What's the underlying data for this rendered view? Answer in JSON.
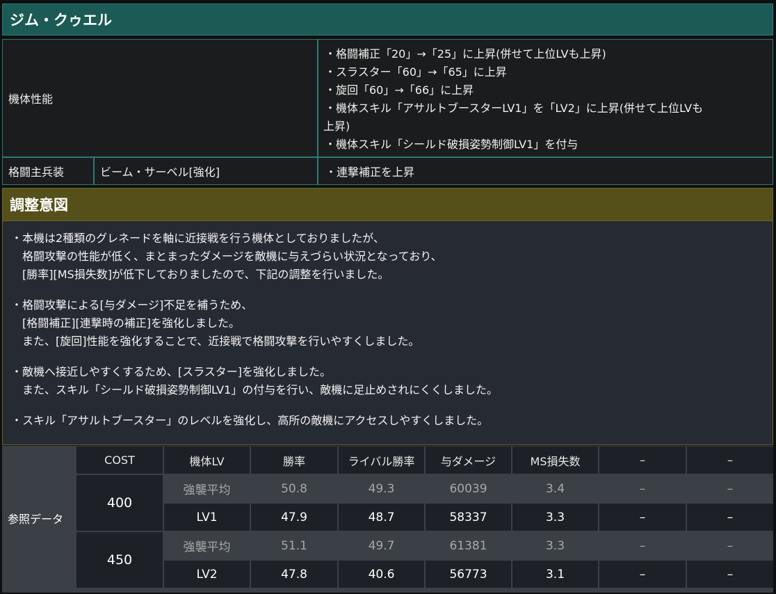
{
  "title": "ジム・クゥエル",
  "performance": {
    "label": "機体性能",
    "items": [
      "・格闘補正「20」→「25」に上昇(併せて上位LVも上昇)",
      "・スラスター「60」→「65」に上昇",
      "・旋回「60」→「66」に上昇",
      "・機体スキル「アサルトブースターLV1」を「LV2」に上昇(併せて上位LVも",
      "上昇)",
      "・機体スキル「シールド破損姿勢制御LV1」を付与"
    ]
  },
  "weapon": {
    "label": "格闘主兵装",
    "name": "ビーム・サーベル[強化]",
    "change": "・連撃補正を上昇"
  },
  "intent": {
    "title": "調整意図",
    "paragraphs": [
      [
        "・本機は2種類のグレネードを軸に近接戦を行う機体としておりましたが、",
        "　格闘攻撃の性能が低く、まとまったダメージを敵機に与えづらい状況となっており、",
        "　[勝率][MS損失数]が低下しておりましたので、下記の調整を行いました。"
      ],
      [
        "・格闘攻撃による[与ダメージ]不足を補うため、",
        "　[格闘補正][連撃時の補正]を強化しました。",
        "　また、[旋回]性能を強化することで、近接戦で格闘攻撃を行いやすくしました。"
      ],
      [
        "・敵機へ接近しやすくするため、[スラスター]を強化しました。",
        "　また、スキル「シールド破損姿勢制御LV1」の付与を行い、敵機に足止めされにくくしました。"
      ],
      [
        "・スキル「アサルトブースター」のレベルを強化し、高所の敵機にアクセスしやすくしました。"
      ]
    ]
  },
  "reference": {
    "label": "参照データ",
    "headers": [
      "COST",
      "機体LV",
      "勝率",
      "ライバル勝率",
      "与ダメージ",
      "MS損失数",
      "–",
      "–"
    ],
    "groups": [
      {
        "cost": "400",
        "rows": [
          [
            "強襲平均",
            "50.8",
            "49.3",
            "60039",
            "3.4",
            "–",
            "–"
          ],
          [
            "LV1",
            "47.9",
            "48.7",
            "58337",
            "3.3",
            "–",
            "–"
          ]
        ]
      },
      {
        "cost": "450",
        "rows": [
          [
            "強襲平均",
            "51.1",
            "49.7",
            "61381",
            "3.3",
            "–",
            "–"
          ],
          [
            "LV2",
            "47.8",
            "40.6",
            "56773",
            "3.1",
            "–",
            "–"
          ]
        ]
      }
    ]
  }
}
